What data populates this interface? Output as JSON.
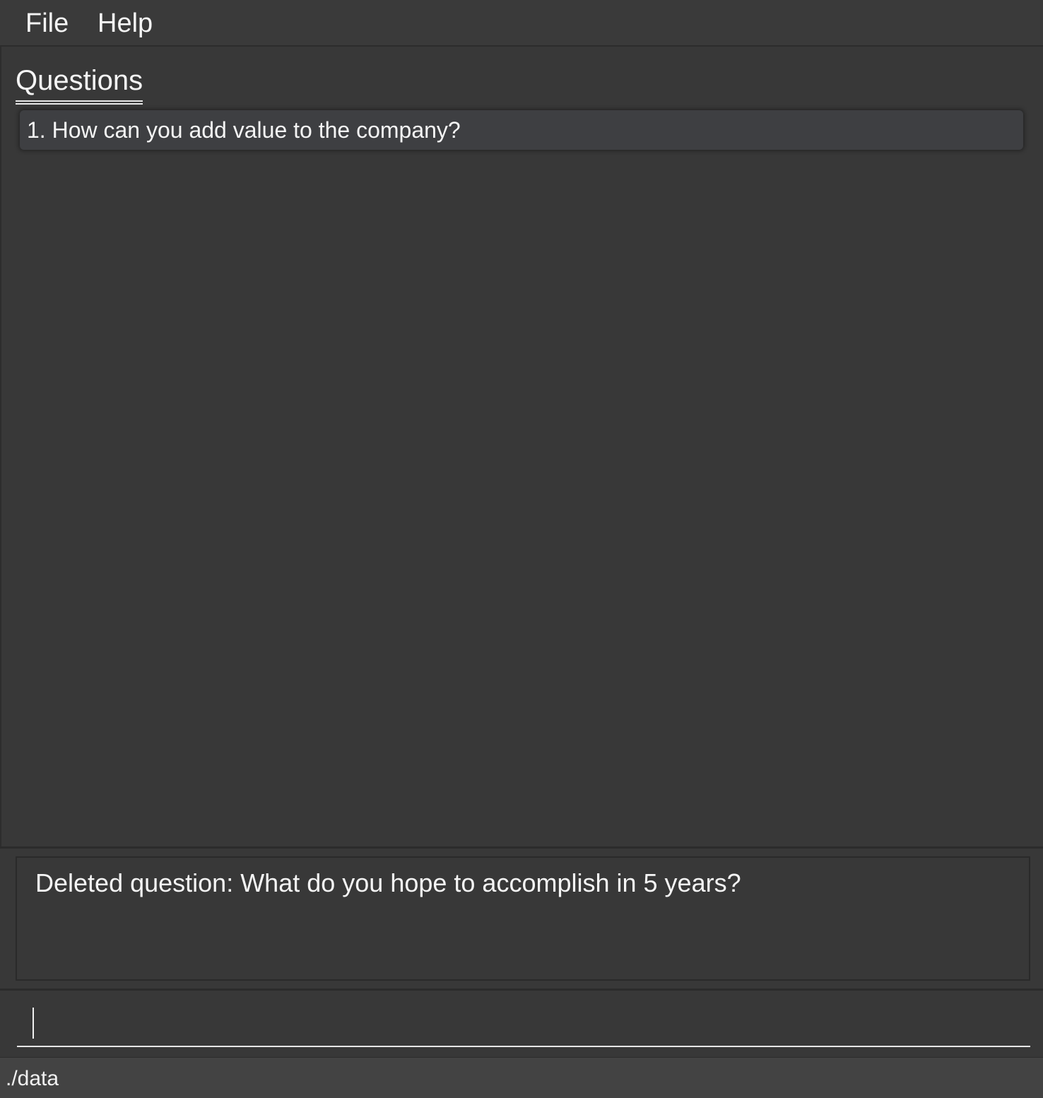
{
  "menu": {
    "file_label": "File",
    "help_label": "Help"
  },
  "questions_panel": {
    "title": "Questions",
    "items": [
      {
        "text": "1. How can you add value to the company?"
      }
    ]
  },
  "result_display": {
    "message": "Deleted question: What do you hope to accomplish in 5 years?"
  },
  "command_box": {
    "value": "",
    "placeholder": ""
  },
  "status_bar": {
    "path": "./data"
  },
  "colors": {
    "background": "#383838",
    "menubar": "#3a3a3a",
    "card": "#3e3f42",
    "status_bar": "#434343",
    "text": "#f5f5f5"
  }
}
